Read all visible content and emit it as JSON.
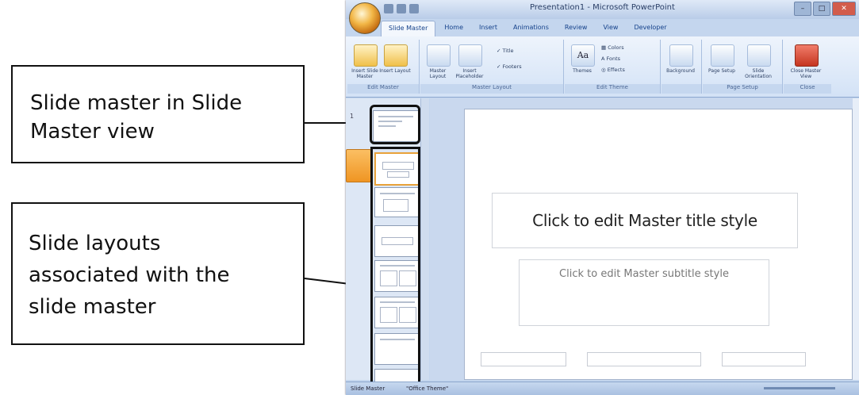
{
  "callouts": [
    {
      "line1": "Slide master in Slide",
      "line2": "Master view"
    },
    {
      "line1": "Slide layouts",
      "line2": "associated with the",
      "line3": "slide master"
    }
  ],
  "window": {
    "title": "Presentation1 - Microsoft PowerPoint"
  },
  "ribbon_tabs": [
    "Slide Master",
    "Home",
    "Insert",
    "Animations",
    "Review",
    "View",
    "Developer"
  ],
  "ribbon": {
    "edit_master": {
      "label": "Edit Master",
      "insert_slide_master": "Insert Slide Master",
      "insert_layout": "Insert Layout"
    },
    "master_layout": {
      "label": "Master Layout",
      "master_layout_btn": "Master Layout",
      "insert_placeholder": "Insert Placeholder",
      "title_check": "Title",
      "footers_check": "Footers"
    },
    "edit_theme": {
      "label": "Edit Theme",
      "themes": "Themes",
      "colors": "Colors",
      "fonts": "Fonts",
      "effects": "Effects"
    },
    "background": {
      "label": "",
      "background": "Background"
    },
    "page_setup": {
      "label": "Page Setup",
      "page_setup_btn": "Page Setup",
      "slide_orientation": "Slide Orientation"
    },
    "close": {
      "label": "Close",
      "close_master_view": "Close Master View"
    }
  },
  "slide": {
    "title_placeholder": "Click to edit Master title style",
    "subtitle_placeholder": "Click to edit Master subtitle style"
  },
  "statusbar": {
    "left": "Slide Master",
    "theme": "\"Office Theme\""
  },
  "colors": {
    "accent": "#f0a030",
    "callout_border": "#111111",
    "ribbon_bg": "#d3e2f6"
  }
}
